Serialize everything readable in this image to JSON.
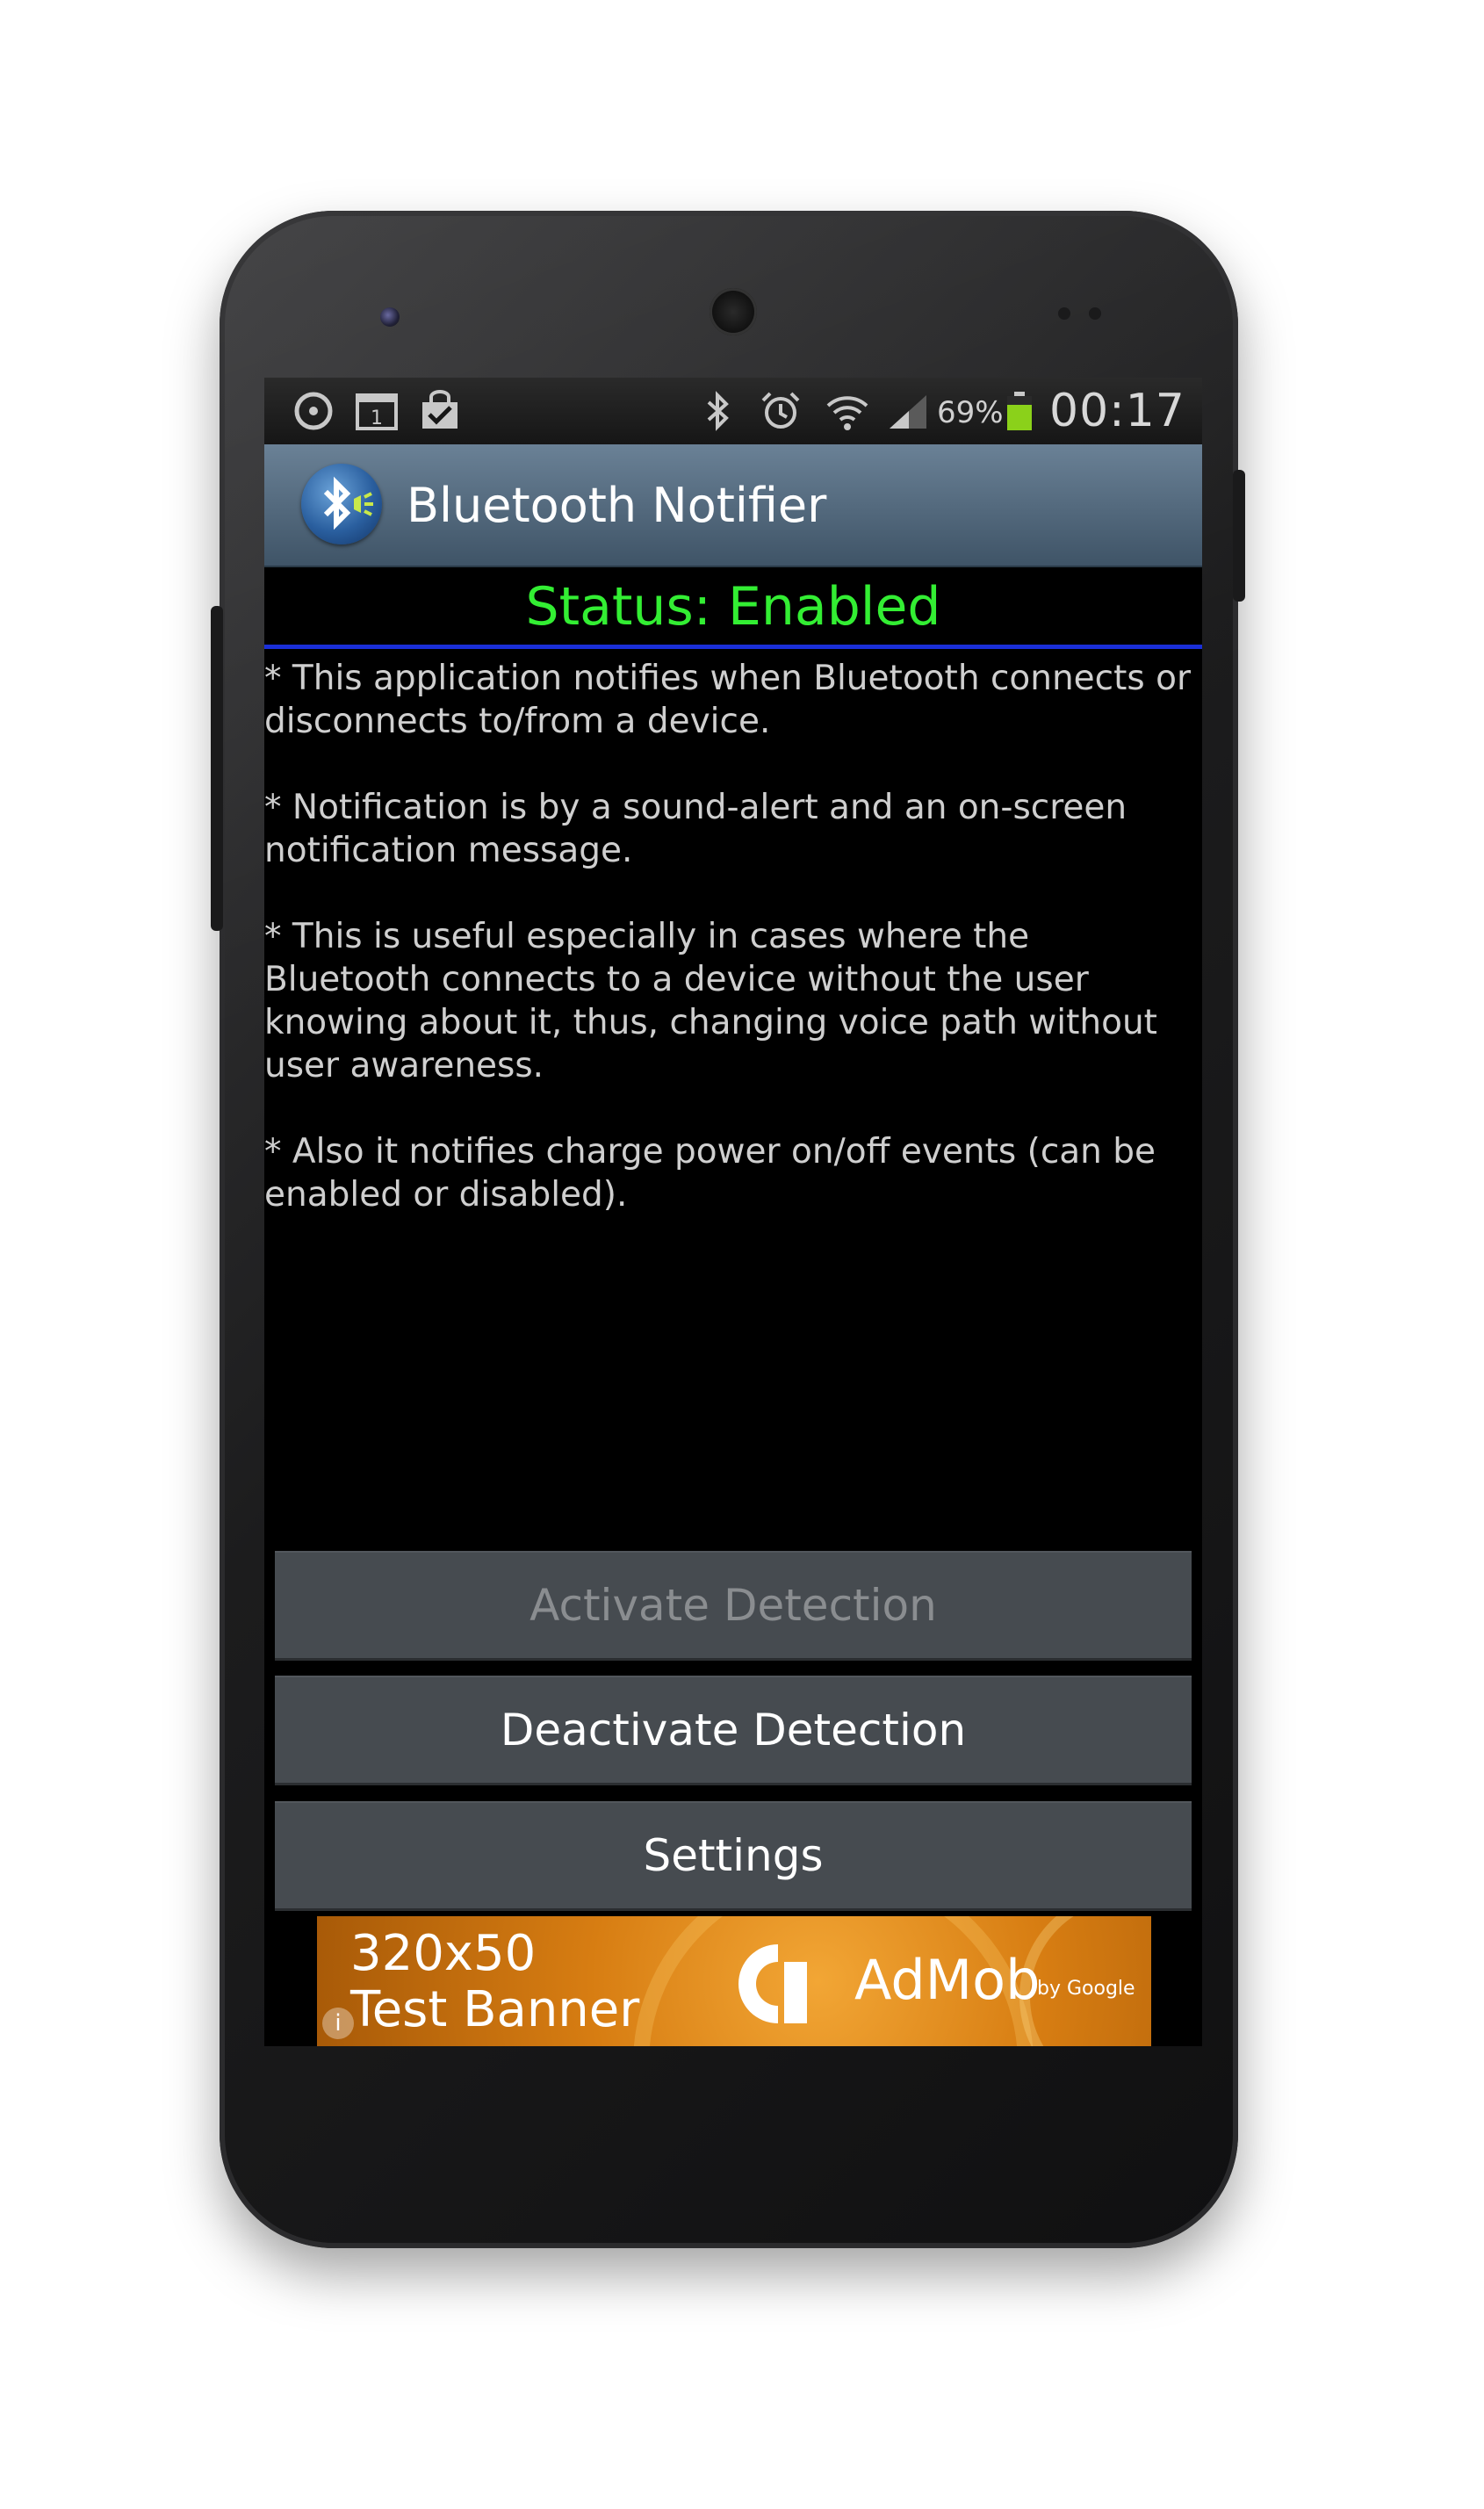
{
  "status_bar": {
    "battery_percent": "69%",
    "time": "00:17",
    "icons": [
      "sync-icon",
      "calendar-icon",
      "shopping-bag-icon",
      "bluetooth-icon",
      "alarm-icon",
      "wifi-icon",
      "signal-icon",
      "battery-icon"
    ],
    "calendar_day": "1"
  },
  "action_bar": {
    "app_icon": "bluetooth-notifier-icon",
    "title": "Bluetooth Notifier"
  },
  "status_text": "Status: Enabled",
  "description": [
    "* This application notifies when Bluetooth connects or disconnects to/from a device.",
    "* Notification is by a sound-alert and an on-screen notification message.",
    "* This is useful especially in cases where the Bluetooth connects to a device without the user knowing about it, thus, changing voice path without user awareness.",
    "* Also it notifies charge power on/off events (can be enabled or disabled)."
  ],
  "buttons": {
    "activate": "Activate Detection",
    "deactivate": "Deactivate Detection",
    "settings": "Settings"
  },
  "ad_banner": {
    "size_text": "320x50",
    "label": "Test Banner",
    "brand": "AdMob",
    "brand_sub": "by Google",
    "info_glyph": "i"
  },
  "colors": {
    "status_green": "#33ee33",
    "divider_blue": "#1a2fd8",
    "action_bar": "#4f6579",
    "button_bg": "#464b50",
    "ad_orange": "#e08a1c"
  }
}
